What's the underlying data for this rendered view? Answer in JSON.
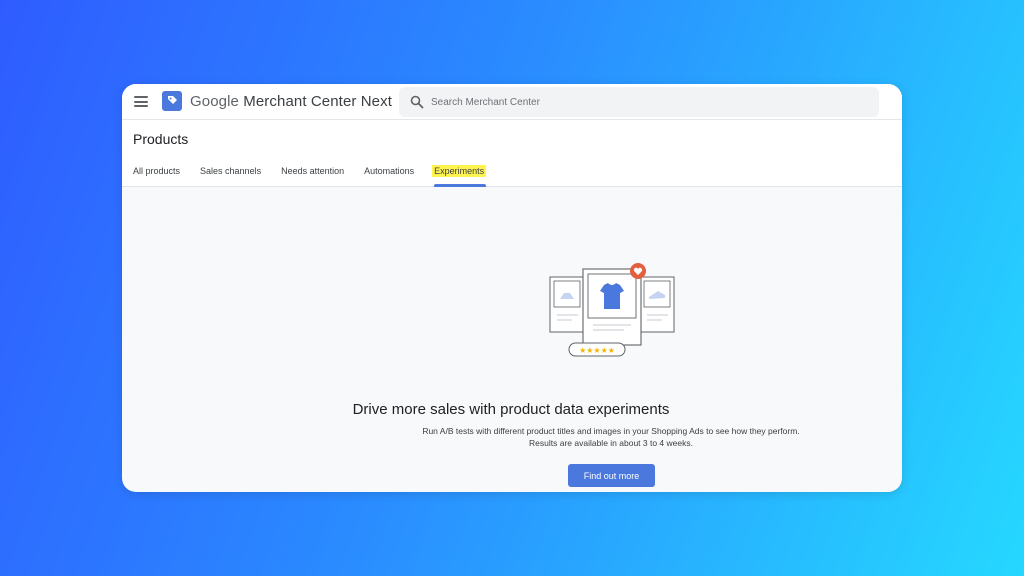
{
  "app": {
    "brand": "Google",
    "product": "Merchant Center Next",
    "icons": {
      "menu": "hamburger-icon",
      "logo": "merchant-center-logo-icon",
      "search": "search-icon"
    }
  },
  "search": {
    "placeholder": "Search Merchant Center",
    "value": ""
  },
  "page": {
    "title": "Products",
    "tabs": [
      {
        "label": "All products"
      },
      {
        "label": "Sales channels"
      },
      {
        "label": "Needs attention"
      },
      {
        "label": "Automations"
      },
      {
        "label": "Experiments",
        "active": true
      }
    ]
  },
  "empty_state": {
    "title": "Drive more sales with product data experiments",
    "description": "Run A/B tests with different product titles and images in your Shopping Ads to see how they perform. Results are available in about 3 to 4 weeks.",
    "button_label": "Find out more",
    "illustration": "product-cards-illustration"
  },
  "colors": {
    "accent": "#4a78dc",
    "highlight": "#fff44f",
    "heart_badge": "#e2603f",
    "stars": "#f4b400"
  }
}
